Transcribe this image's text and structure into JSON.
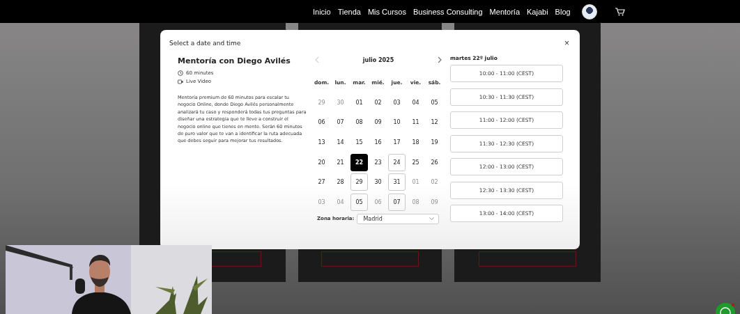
{
  "nav": {
    "items": [
      {
        "label": "Inicio"
      },
      {
        "label": "Tienda"
      },
      {
        "label": "Mis Cursos"
      },
      {
        "label": "Business Consulting"
      },
      {
        "label": "Mentoría"
      },
      {
        "label": "Kajabi"
      },
      {
        "label": "Blog"
      }
    ]
  },
  "modal": {
    "title": "Select a date and time",
    "close": "×",
    "event": {
      "name": "Mentoría con Diego Avilés",
      "duration": "60 minutes",
      "location": "Live Video",
      "description": "Mentoría premium de 60 minutos para escalar tu negocio Online, donde Diego Avilés personalmente analizará tu caso y responderá todas tus preguntas para diseñar una estrategia que te lleve a construir el negocio online que tienes en mente. Serán 60 minutos de puro valor que te van a identificar la ruta adecuada que debes seguir para mejorar tus resultados."
    },
    "calendar": {
      "month": "julio 2025",
      "weekdays": [
        "dom.",
        "lun.",
        "mar.",
        "mié.",
        "jue.",
        "vie.",
        "sáb."
      ],
      "weeks": [
        [
          {
            "label": "29",
            "disabled": true,
            "available": false,
            "selected": false
          },
          {
            "label": "30",
            "disabled": true,
            "available": false,
            "selected": false
          },
          {
            "label": "01",
            "disabled": false,
            "available": false,
            "selected": false
          },
          {
            "label": "02",
            "disabled": false,
            "available": false,
            "selected": false
          },
          {
            "label": "03",
            "disabled": false,
            "available": false,
            "selected": false
          },
          {
            "label": "04",
            "disabled": false,
            "available": false,
            "selected": false
          },
          {
            "label": "05",
            "disabled": false,
            "available": false,
            "selected": false
          }
        ],
        [
          {
            "label": "06",
            "disabled": false,
            "available": false,
            "selected": false
          },
          {
            "label": "07",
            "disabled": false,
            "available": false,
            "selected": false
          },
          {
            "label": "08",
            "disabled": false,
            "available": false,
            "selected": false
          },
          {
            "label": "09",
            "disabled": false,
            "available": false,
            "selected": false
          },
          {
            "label": "10",
            "disabled": false,
            "available": false,
            "selected": false
          },
          {
            "label": "11",
            "disabled": false,
            "available": false,
            "selected": false
          },
          {
            "label": "12",
            "disabled": false,
            "available": false,
            "selected": false
          }
        ],
        [
          {
            "label": "13",
            "disabled": false,
            "available": false,
            "selected": false
          },
          {
            "label": "14",
            "disabled": false,
            "available": false,
            "selected": false
          },
          {
            "label": "15",
            "disabled": false,
            "available": false,
            "selected": false
          },
          {
            "label": "16",
            "disabled": false,
            "available": false,
            "selected": false
          },
          {
            "label": "17",
            "disabled": false,
            "available": false,
            "selected": false
          },
          {
            "label": "18",
            "disabled": false,
            "available": false,
            "selected": false
          },
          {
            "label": "19",
            "disabled": false,
            "available": false,
            "selected": false
          }
        ],
        [
          {
            "label": "20",
            "disabled": false,
            "available": false,
            "selected": false
          },
          {
            "label": "21",
            "disabled": false,
            "available": false,
            "selected": false
          },
          {
            "label": "22",
            "disabled": false,
            "available": true,
            "selected": true
          },
          {
            "label": "23",
            "disabled": false,
            "available": false,
            "selected": false
          },
          {
            "label": "24",
            "disabled": false,
            "available": true,
            "selected": false
          },
          {
            "label": "25",
            "disabled": false,
            "available": false,
            "selected": false
          },
          {
            "label": "26",
            "disabled": false,
            "available": false,
            "selected": false
          }
        ],
        [
          {
            "label": "27",
            "disabled": false,
            "available": false,
            "selected": false
          },
          {
            "label": "28",
            "disabled": false,
            "available": false,
            "selected": false
          },
          {
            "label": "29",
            "disabled": false,
            "available": true,
            "selected": false
          },
          {
            "label": "30",
            "disabled": false,
            "available": false,
            "selected": false
          },
          {
            "label": "31",
            "disabled": false,
            "available": true,
            "selected": false
          },
          {
            "label": "01",
            "disabled": true,
            "available": false,
            "selected": false
          },
          {
            "label": "02",
            "disabled": true,
            "available": false,
            "selected": false
          }
        ],
        [
          {
            "label": "03",
            "disabled": true,
            "available": false,
            "selected": false
          },
          {
            "label": "04",
            "disabled": true,
            "available": false,
            "selected": false
          },
          {
            "label": "05",
            "disabled": false,
            "available": true,
            "selected": false
          },
          {
            "label": "06",
            "disabled": true,
            "available": false,
            "selected": false
          },
          {
            "label": "07",
            "disabled": false,
            "available": true,
            "selected": false
          },
          {
            "label": "08",
            "disabled": true,
            "available": false,
            "selected": false
          },
          {
            "label": "09",
            "disabled": true,
            "available": false,
            "selected": false
          }
        ]
      ],
      "prev_disabled": true
    },
    "timezone": {
      "label": "Zona horaria:",
      "value": "Madrid"
    },
    "slots": {
      "date": "martes 22º julio",
      "items": [
        {
          "label": "10:00 - 11:00 (CEST)",
          "selected": false
        },
        {
          "label": "10:30 - 11:30 (CEST)",
          "selected": false
        },
        {
          "label": "11:00 - 12:00 (CEST)",
          "selected": false
        },
        {
          "label": "11:30 - 12:30 (CEST)",
          "selected": false
        },
        {
          "label": "12:00 - 13:00 (CEST)",
          "selected": false
        },
        {
          "label": "12:30 - 13:30 (CEST)",
          "selected": false
        },
        {
          "label": "13:00 - 14:00 (CEST)",
          "selected": false
        }
      ]
    }
  }
}
